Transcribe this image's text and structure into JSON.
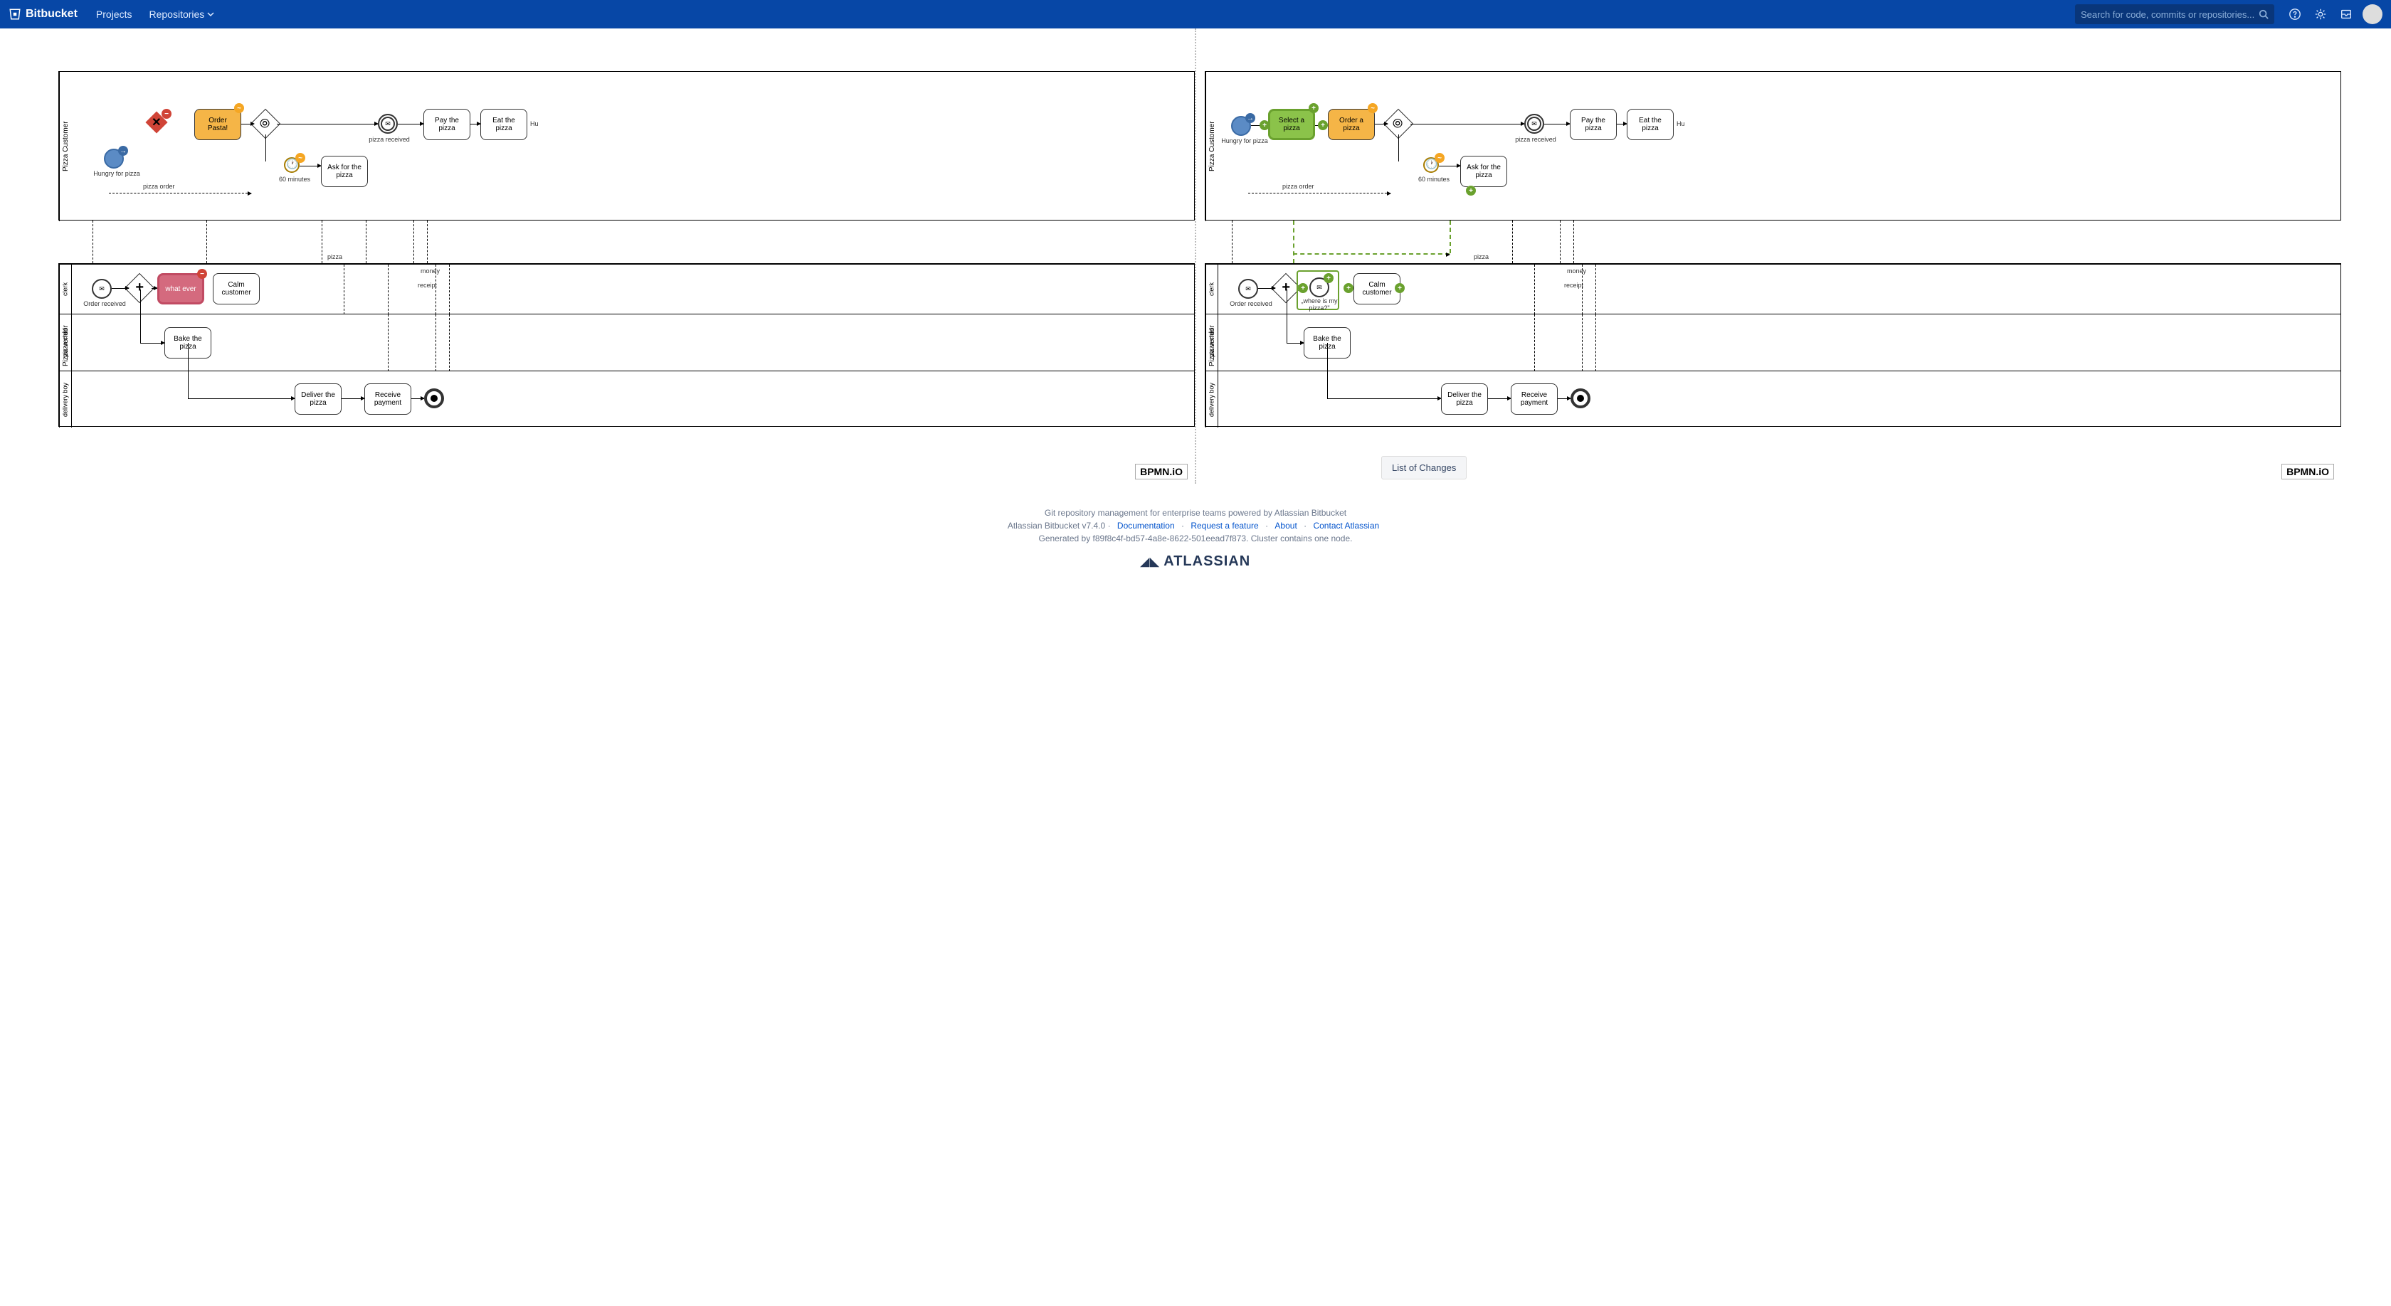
{
  "header": {
    "product": "Bitbucket",
    "nav": {
      "projects": "Projects",
      "repositories": "Repositories"
    },
    "search_placeholder": "Search for code, commits or repositories..."
  },
  "diagram": {
    "pool1_label": "Pizza Customer",
    "pool2_label": "Pizza vendor",
    "lanes": {
      "clerk": "clerk",
      "chef": "pizza chef",
      "delivery": "delivery boy"
    },
    "left": {
      "start_label": "Hungry for pizza",
      "order_task": "Order Pasta!",
      "select_task": null,
      "order_a_pizza_task": null,
      "pay_task": "Pay the pizza",
      "eat_task": "Eat the pizza",
      "hu": "Hu",
      "pizza_received": "pizza received",
      "timer_label": "60 minutes",
      "ask_task": "Ask for the pizza",
      "pizza_order": "pizza order",
      "pizza": "pizza",
      "money": "money",
      "receipt": "receipt",
      "order_received": "Order received",
      "calm": "Calm customer",
      "what_ever": "what ever",
      "where_pizza": null,
      "bake": "Bake the pizza",
      "deliver": "Deliver the pizza",
      "receive_pay": "Receive payment"
    },
    "right": {
      "start_label": "Hungry for pizza",
      "order_task": null,
      "select_task": "Select a pizza",
      "order_a_pizza_task": "Order a pizza",
      "pay_task": "Pay the pizza",
      "eat_task": "Eat the pizza",
      "hu": "Hu",
      "pizza_received": "pizza received",
      "timer_label": "60 minutes",
      "ask_task": "Ask for the pizza",
      "pizza_order": "pizza order",
      "pizza": "pizza",
      "money": "money",
      "receipt": "receipt",
      "order_received": "Order received",
      "calm": "Calm customer",
      "what_ever": null,
      "where_pizza": "„where is my pizza?\"",
      "bake": "Bake the pizza",
      "deliver": "Deliver the pizza",
      "receive_pay": "Receive payment"
    }
  },
  "bpmn_logo": "BPMN.iO",
  "changes_button": "List of Changes",
  "footer": {
    "tagline": "Git repository management for enterprise teams powered by Atlassian Bitbucket",
    "version": "Atlassian Bitbucket v7.4.0",
    "docs": "Documentation",
    "request": "Request a feature",
    "about": "About",
    "contact": "Contact Atlassian",
    "generated": "Generated by f89f8c4f-bd57-4a8e-8622-501eead7f873. Cluster contains one node.",
    "atlassian": "ATLASSIAN"
  }
}
